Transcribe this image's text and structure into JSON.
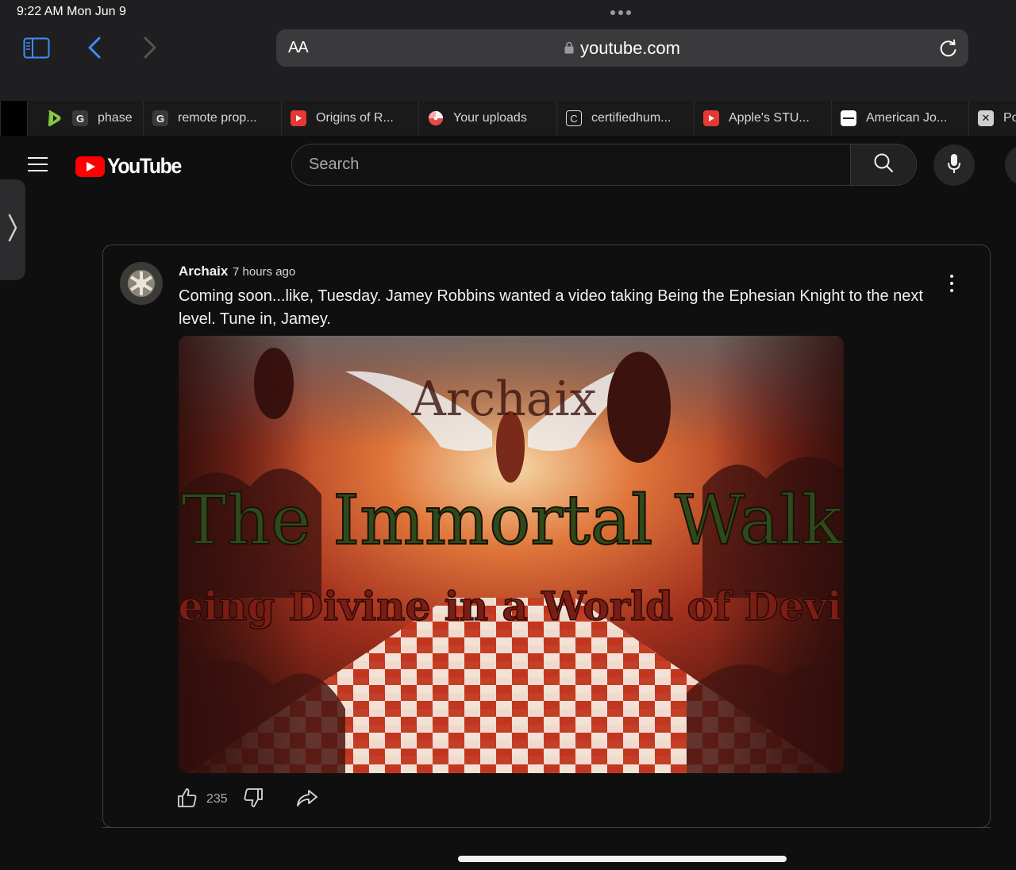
{
  "status_bar": {
    "time": "9:22 AM   Mon Jun 9"
  },
  "safari": {
    "text_size_label": "AA",
    "url": "youtube.com"
  },
  "tabs": [
    {
      "label": "",
      "favicon": "rumble-icon"
    },
    {
      "label": "phase",
      "favicon": "G"
    },
    {
      "label": "remote prop...",
      "favicon": "G"
    },
    {
      "label": "Origins of R...",
      "favicon": "youtube-icon"
    },
    {
      "label": "Your uploads",
      "favicon": "pinwheel-icon"
    },
    {
      "label": "certifiedhum...",
      "favicon": "C"
    },
    {
      "label": "Apple's STU...",
      "favicon": "youtube-icon"
    },
    {
      "label": "American Jo...",
      "favicon": "journal-icon"
    },
    {
      "label": "Po",
      "favicon": "X"
    }
  ],
  "youtube": {
    "logo_text": "YouTube",
    "search_placeholder": "Search"
  },
  "post": {
    "author": "Archaix",
    "time_ago": "7 hours ago",
    "text": "Coming soon...like, Tuesday.  Jamey Robbins wanted a video taking Being the Ephesian Knight to the next level.  Tune in, Jamey.",
    "image": {
      "watermark": "Archaix",
      "title": "The Immortal Walk",
      "subtitle": "Being Divine in a World of Devils"
    },
    "like_count": "235"
  },
  "colors": {
    "accent_red": "#ff0000",
    "background": "#0f0f0f",
    "chrome": "#1f1f21"
  }
}
